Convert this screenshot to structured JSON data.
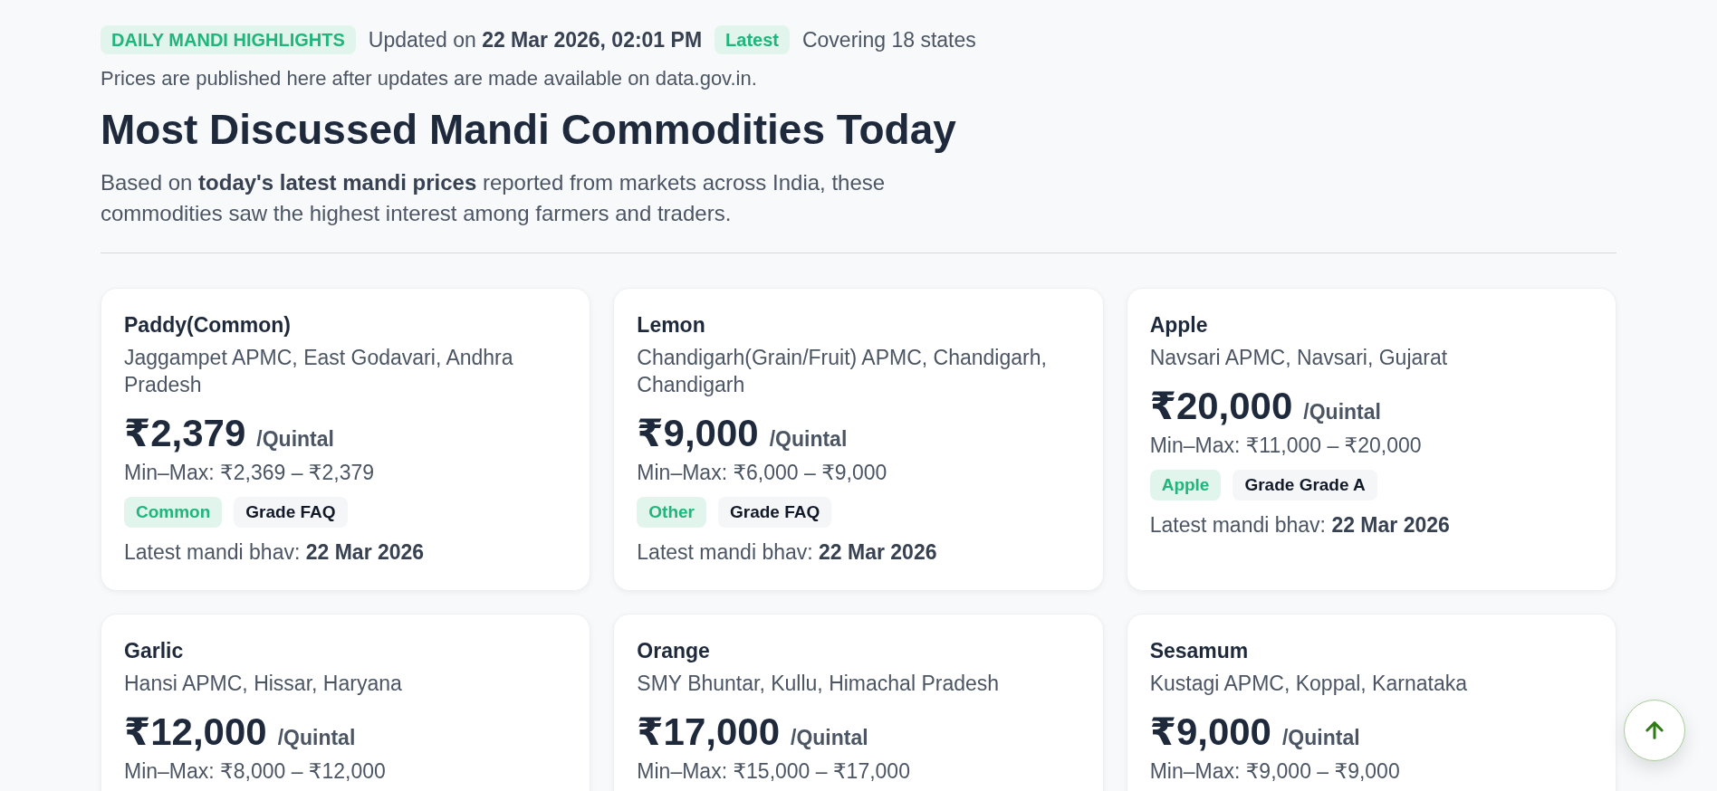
{
  "header": {
    "badge": "DAILY MANDI HIGHLIGHTS",
    "updated": "Updated on **22 Mar 2026, 02:01 PM**",
    "status_badge": "Latest",
    "coverage": "Covering 18 states"
  },
  "note": "Prices are published here after updates are made available on data.gov.in.",
  "title": "Most Discussed Mandi Commodities Today",
  "description": "Based on **today's latest mandi prices** reported from markets across India, these commodities saw the highest interest among farmers and traders.",
  "cards": [
    {
      "name": "Paddy(Common)",
      "location": "Jaggampet APMC, East Godavari, Andhra Pradesh",
      "price": "₹2,379",
      "unit": "/Quintal",
      "range": "Min–Max: ₹2,369 – ₹2,379",
      "tags": [
        {
          "label": "Common",
          "kind": "variety"
        },
        {
          "label": "Grade FAQ",
          "kind": "grade"
        }
      ],
      "latest": "Latest mandi bhav: **22 Mar 2026**"
    },
    {
      "name": "Lemon",
      "location": "Chandigarh(Grain/Fruit) APMC, Chandigarh, Chandigarh",
      "price": "₹9,000",
      "unit": "/Quintal",
      "range": "Min–Max: ₹6,000 – ₹9,000",
      "tags": [
        {
          "label": "Other",
          "kind": "variety"
        },
        {
          "label": "Grade FAQ",
          "kind": "grade"
        }
      ],
      "latest": "Latest mandi bhav: **22 Mar 2026**"
    },
    {
      "name": "Apple",
      "location": "Navsari APMC, Navsari, Gujarat",
      "price": "₹20,000",
      "unit": "/Quintal",
      "range": "Min–Max: ₹11,000 – ₹20,000",
      "tags": [
        {
          "label": "Apple",
          "kind": "variety"
        },
        {
          "label": "Grade Grade A",
          "kind": "grade"
        }
      ],
      "latest": "Latest mandi bhav: **22 Mar 2026**"
    },
    {
      "name": "Garlic",
      "location": "Hansi APMC, Hissar, Haryana",
      "price": "₹12,000",
      "unit": "/Quintal",
      "range": "Min–Max: ₹8,000 – ₹12,000"
    },
    {
      "name": "Orange",
      "location": "SMY Bhuntar, Kullu, Himachal Pradesh",
      "price": "₹17,000",
      "unit": "/Quintal",
      "range": "Min–Max: ₹15,000 – ₹17,000"
    },
    {
      "name": "Sesamum",
      "location": "Kustagi APMC, Koppal, Karnataka",
      "price": "₹9,000",
      "unit": "/Quintal",
      "range": "Min–Max: ₹9,000 – ₹9,000"
    }
  ]
}
